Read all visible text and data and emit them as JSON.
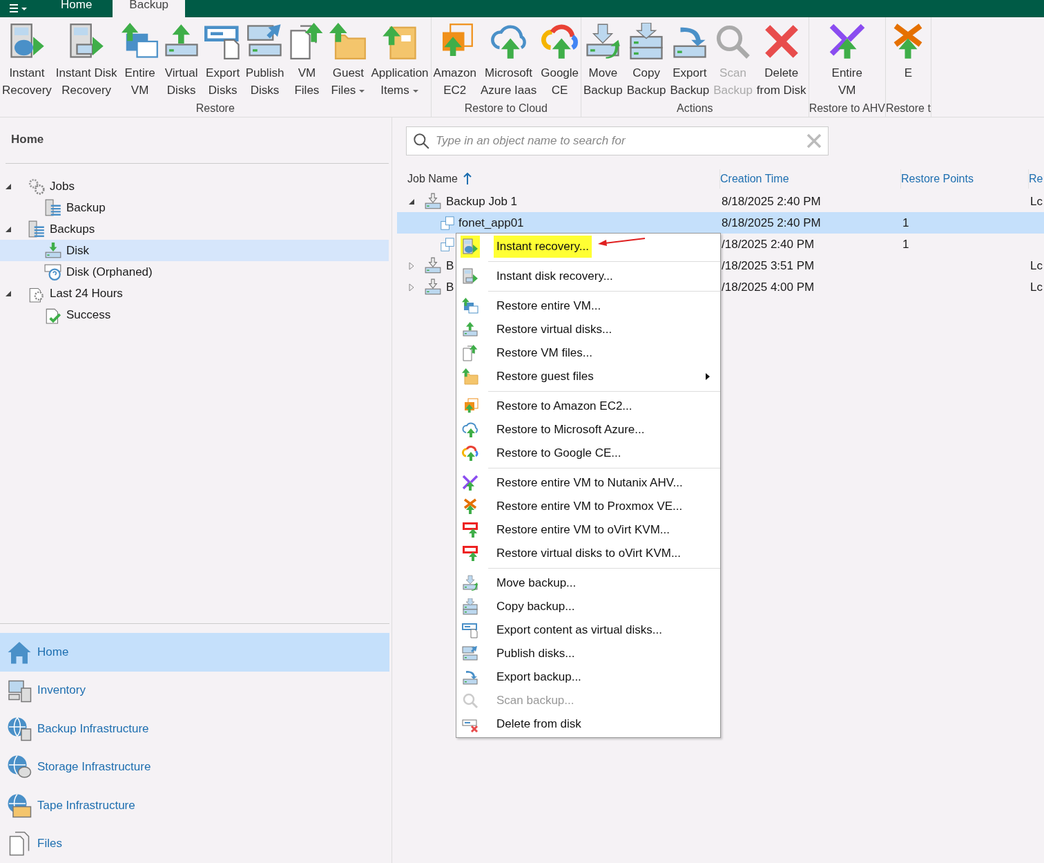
{
  "tabs": [
    {
      "label": "Home",
      "selected": false
    },
    {
      "label": "Backup",
      "selected": true
    }
  ],
  "ribbon": {
    "groups": [
      {
        "label": "Restore",
        "buttons": [
          {
            "lines": [
              "Instant",
              "Recovery"
            ],
            "dropdown": false,
            "disabled": false
          },
          {
            "lines": [
              "Instant Disk",
              "Recovery"
            ],
            "dropdown": false,
            "disabled": false
          },
          {
            "lines": [
              "Entire",
              "VM"
            ],
            "dropdown": false,
            "disabled": false
          },
          {
            "lines": [
              "Virtual",
              "Disks"
            ],
            "dropdown": false,
            "disabled": false
          },
          {
            "lines": [
              "Export",
              "Disks"
            ],
            "dropdown": false,
            "disabled": false
          },
          {
            "lines": [
              "Publish",
              "Disks"
            ],
            "dropdown": false,
            "disabled": false
          },
          {
            "lines": [
              "VM",
              "Files"
            ],
            "dropdown": false,
            "disabled": false
          },
          {
            "lines": [
              "Guest",
              "Files"
            ],
            "dropdown": true,
            "disabled": false
          },
          {
            "lines": [
              "Application",
              "Items"
            ],
            "dropdown": true,
            "disabled": false
          }
        ]
      },
      {
        "label": "Restore to Cloud",
        "buttons": [
          {
            "lines": [
              "Amazon",
              "EC2"
            ],
            "dropdown": false,
            "disabled": false
          },
          {
            "lines": [
              "Microsoft",
              "Azure Iaas"
            ],
            "dropdown": false,
            "disabled": false
          },
          {
            "lines": [
              "Google",
              "CE"
            ],
            "dropdown": false,
            "disabled": false
          }
        ]
      },
      {
        "label": "Actions",
        "buttons": [
          {
            "lines": [
              "Move",
              "Backup"
            ],
            "dropdown": false,
            "disabled": false
          },
          {
            "lines": [
              "Copy",
              "Backup"
            ],
            "dropdown": false,
            "disabled": false
          },
          {
            "lines": [
              "Export",
              "Backup"
            ],
            "dropdown": false,
            "disabled": false
          },
          {
            "lines": [
              "Scan",
              "Backup"
            ],
            "dropdown": false,
            "disabled": true
          },
          {
            "lines": [
              "Delete",
              "from Disk"
            ],
            "dropdown": false,
            "disabled": false
          }
        ]
      },
      {
        "label": "Restore to AHV",
        "buttons": [
          {
            "lines": [
              "Entire",
              "VM"
            ],
            "dropdown": false,
            "disabled": false
          }
        ]
      },
      {
        "label": "Restore t",
        "buttons": [
          {
            "lines": [
              "E"
            ],
            "dropdown": false,
            "disabled": false
          }
        ]
      }
    ]
  },
  "sidebar": {
    "title": "Home",
    "tree": [
      {
        "label": "Jobs",
        "expanded": true,
        "selected": false,
        "children": [
          {
            "label": "Backup",
            "selected": false
          }
        ]
      },
      {
        "label": "Backups",
        "expanded": true,
        "selected": false,
        "children": [
          {
            "label": "Disk",
            "selected": true
          },
          {
            "label": "Disk (Orphaned)",
            "selected": false
          }
        ]
      },
      {
        "label": "Last 24 Hours",
        "expanded": true,
        "selected": false,
        "children": [
          {
            "label": "Success",
            "selected": false
          }
        ]
      }
    ],
    "nav": [
      {
        "label": "Home",
        "selected": true
      },
      {
        "label": "Inventory",
        "selected": false
      },
      {
        "label": "Backup Infrastructure",
        "selected": false
      },
      {
        "label": "Storage Infrastructure",
        "selected": false
      },
      {
        "label": "Tape Infrastructure",
        "selected": false
      },
      {
        "label": "Files",
        "selected": false
      }
    ]
  },
  "search": {
    "placeholder": "Type in an object name to search for"
  },
  "table": {
    "columns": [
      {
        "label": "Job Name",
        "sorted": true
      },
      {
        "label": "Creation Time",
        "sorted": false
      },
      {
        "label": "Restore Points",
        "sorted": false
      },
      {
        "label": "Re",
        "sorted": false
      }
    ],
    "rows": [
      {
        "name": "Backup Job 1",
        "expanded": true,
        "selected": false,
        "creation_time": "8/18/2025 2:40 PM",
        "column_4": "Lc",
        "children": [
          {
            "name": "fonet_app01",
            "selected": true,
            "creation_time": "8/18/2025 2:40 PM",
            "restore_points": "1"
          },
          {
            "selected": false,
            "creation_time": "/18/2025 2:40 PM",
            "restore_points": "1"
          }
        ]
      },
      {
        "name": "B",
        "expanded": false,
        "selected": false,
        "creation_time": "/18/2025 3:51 PM",
        "column_4": "Lc"
      },
      {
        "name": "B",
        "expanded": false,
        "selected": false,
        "creation_time": "/18/2025 4:00 PM",
        "column_4": "Lc"
      }
    ]
  },
  "context_menu": {
    "groups": [
      [
        {
          "label": "Instant recovery...",
          "selected": true,
          "disabled": false,
          "submenu": false
        }
      ],
      [
        {
          "label": "Instant disk recovery...",
          "selected": false,
          "disabled": false,
          "submenu": false
        }
      ],
      [
        {
          "label": "Restore entire VM...",
          "selected": false,
          "disabled": false,
          "submenu": false
        },
        {
          "label": "Restore virtual disks...",
          "selected": false,
          "disabled": false,
          "submenu": false
        },
        {
          "label": "Restore VM files...",
          "selected": false,
          "disabled": false,
          "submenu": false
        },
        {
          "label": "Restore guest files",
          "selected": false,
          "disabled": false,
          "submenu": true
        }
      ],
      [
        {
          "label": "Restore to Amazon EC2...",
          "selected": false,
          "disabled": false,
          "submenu": false
        },
        {
          "label": "Restore to Microsoft Azure...",
          "selected": false,
          "disabled": false,
          "submenu": false
        },
        {
          "label": "Restore to Google CE...",
          "selected": false,
          "disabled": false,
          "submenu": false
        }
      ],
      [
        {
          "label": "Restore entire VM to Nutanix AHV...",
          "selected": false,
          "disabled": false,
          "submenu": false
        },
        {
          "label": "Restore entire VM to Proxmox VE...",
          "selected": false,
          "disabled": false,
          "submenu": false
        },
        {
          "label": "Restore entire VM to oVirt KVM...",
          "selected": false,
          "disabled": false,
          "submenu": false
        },
        {
          "label": "Restore virtual disks to oVirt KVM...",
          "selected": false,
          "disabled": false,
          "submenu": false
        }
      ],
      [
        {
          "label": "Move backup...",
          "selected": false,
          "disabled": false,
          "submenu": false
        },
        {
          "label": "Copy backup...",
          "selected": false,
          "disabled": false,
          "submenu": false
        },
        {
          "label": "Export content as virtual disks...",
          "selected": false,
          "disabled": false,
          "submenu": false
        },
        {
          "label": "Publish disks...",
          "selected": false,
          "disabled": false,
          "submenu": false
        },
        {
          "label": "Export backup...",
          "selected": false,
          "disabled": false,
          "submenu": false
        },
        {
          "label": "Scan backup...",
          "selected": false,
          "disabled": true,
          "submenu": false
        },
        {
          "label": "Delete from disk",
          "selected": false,
          "disabled": false,
          "submenu": false
        }
      ]
    ]
  }
}
